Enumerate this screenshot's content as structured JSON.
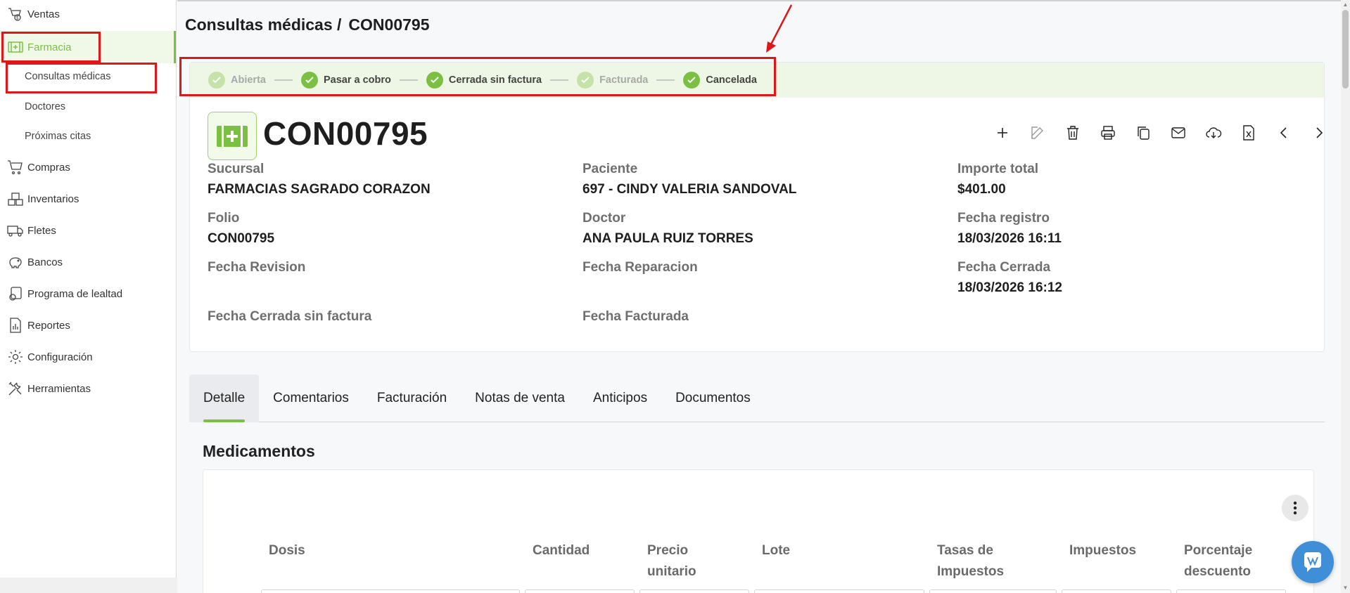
{
  "colors": {
    "accent": "#7bc043",
    "accent_light": "#c5e3a8",
    "highlight_box": "#e0161b",
    "chat": "#3f8fd8"
  },
  "sidebar": {
    "items": [
      {
        "label": "Ventas",
        "icon": "sales-icon"
      },
      {
        "label": "Farmacia",
        "icon": "pharmacy-icon",
        "active": true
      },
      {
        "label": "Compras",
        "icon": "cart-icon"
      },
      {
        "label": "Inventarios",
        "icon": "boxes-icon"
      },
      {
        "label": "Fletes",
        "icon": "truck-icon"
      },
      {
        "label": "Bancos",
        "icon": "piggy-bank-icon"
      },
      {
        "label": "Programa de lealtad",
        "icon": "loyalty-icon"
      },
      {
        "label": "Reportes",
        "icon": "report-icon"
      },
      {
        "label": "Configuración",
        "icon": "gear-icon"
      },
      {
        "label": "Herramientas",
        "icon": "tools-icon"
      }
    ],
    "subitems": [
      {
        "label": "Consultas médicas",
        "active": true
      },
      {
        "label": "Doctores"
      },
      {
        "label": "Próximas citas"
      }
    ]
  },
  "breadcrumb": {
    "section": "Consultas médicas /",
    "record": "CON00795"
  },
  "status_steps": [
    {
      "label": "Abierta",
      "done": false
    },
    {
      "label": "Pasar a cobro",
      "done": true
    },
    {
      "label": "Cerrada sin factura",
      "done": true
    },
    {
      "label": "Facturada",
      "done": false
    },
    {
      "label": "Cancelada",
      "done": true
    }
  ],
  "record": {
    "title": "CON00795",
    "fields": {
      "sucursal_label": "Sucursal",
      "sucursal_value": "FARMACIAS SAGRADO CORAZON",
      "paciente_label": "Paciente",
      "paciente_value": "697 - CINDY VALERIA SANDOVAL",
      "importe_label": "Importe total",
      "importe_value": "$401.00",
      "folio_label": "Folio",
      "folio_value": "CON00795",
      "doctor_label": "Doctor",
      "doctor_value": "ANA PAULA RUIZ TORRES",
      "fecha_registro_label": "Fecha registro",
      "fecha_registro_value": "18/03/2026 16:11",
      "fecha_revision_label": "Fecha Revision",
      "fecha_reparacion_label": "Fecha Reparacion",
      "fecha_cerrada_label": "Fecha Cerrada",
      "fecha_cerrada_value": "18/03/2026 16:12",
      "fecha_cerrada_sf_label": "Fecha Cerrada sin factura",
      "fecha_facturada_label": "Fecha Facturada"
    }
  },
  "toolbar": [
    "plus-icon",
    "edit-icon",
    "trash-icon",
    "print-icon",
    "copy-icon",
    "mail-icon",
    "cloud-download-icon",
    "excel-icon",
    "chevron-left-icon",
    "chevron-right-icon"
  ],
  "tabs": [
    {
      "label": "Detalle",
      "active": true
    },
    {
      "label": "Comentarios"
    },
    {
      "label": "Facturación"
    },
    {
      "label": "Notas de venta"
    },
    {
      "label": "Anticipos"
    },
    {
      "label": "Documentos"
    }
  ],
  "medicamentos": {
    "title": "Medicamentos",
    "columns": [
      {
        "line1": "Dosis",
        "line2": ""
      },
      {
        "line1": "Cantidad",
        "line2": ""
      },
      {
        "line1": "Precio",
        "line2": "unitario"
      },
      {
        "line1": "Lote",
        "line2": ""
      },
      {
        "line1": "Tasas de",
        "line2": "Impuestos"
      },
      {
        "line1": "Impuestos",
        "line2": ""
      },
      {
        "line1": "Porcentaje",
        "line2": "descuento"
      }
    ]
  }
}
